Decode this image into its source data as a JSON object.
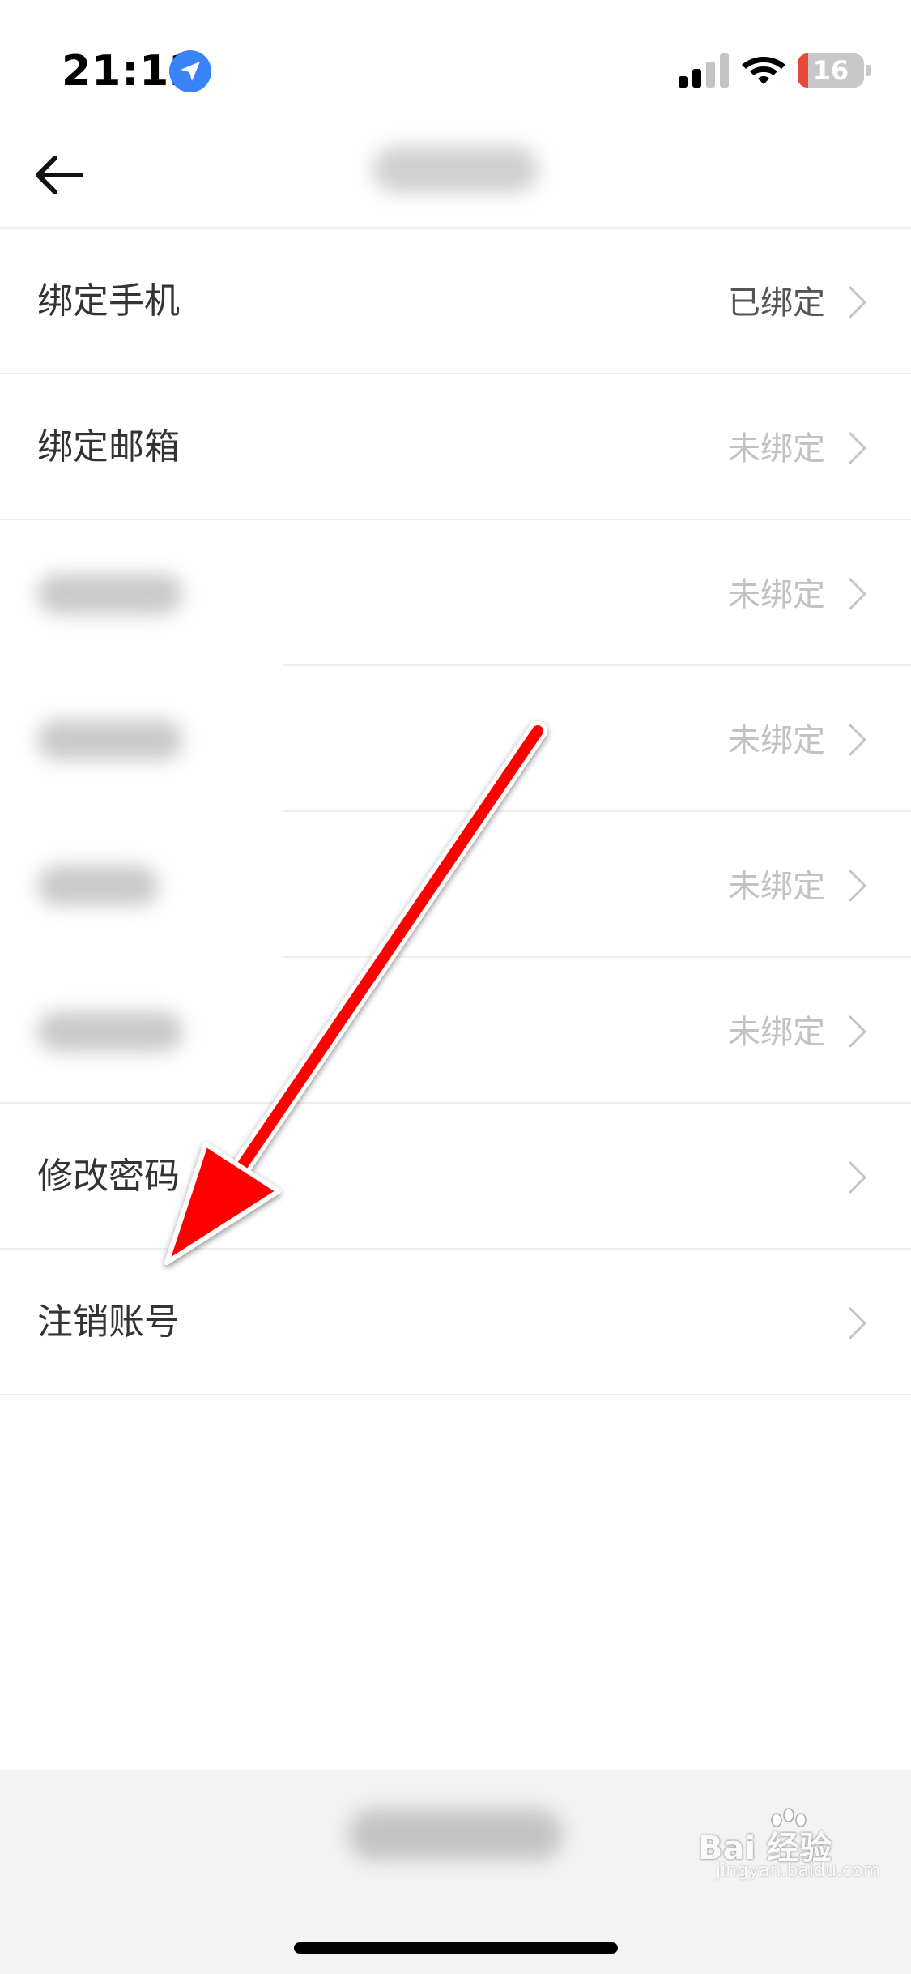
{
  "status_bar": {
    "time": "21:12",
    "battery_level": 16,
    "battery_text": "16",
    "icons": [
      "location-arrow-icon",
      "cellular-signal-icon",
      "wifi-icon",
      "battery-icon"
    ]
  },
  "nav": {
    "back_icon": "back-arrow-icon"
  },
  "items": [
    {
      "label": "绑定手机",
      "value": "已绑定",
      "status": "bound"
    },
    {
      "label": "绑定邮箱",
      "value": "未绑定",
      "status": "unbound"
    },
    {
      "label": "",
      "value": "未绑定",
      "status": "unbound"
    },
    {
      "label": "",
      "value": "未绑定",
      "status": "unbound"
    },
    {
      "label": "",
      "value": "未绑定",
      "status": "unbound"
    },
    {
      "label": "",
      "value": "未绑定",
      "status": "unbound"
    },
    {
      "label": "修改密码",
      "value": "",
      "status": ""
    },
    {
      "label": "注销账号",
      "value": "",
      "status": ""
    }
  ],
  "watermark": {
    "text": "Bai 经验",
    "subtext": "jingyan.baidu.com"
  },
  "colors": {
    "location": "#3a82f7",
    "battery_low": "#e5493a",
    "annotation_arrow": "#ff0000",
    "unbound_text": "#c2c2c2"
  }
}
